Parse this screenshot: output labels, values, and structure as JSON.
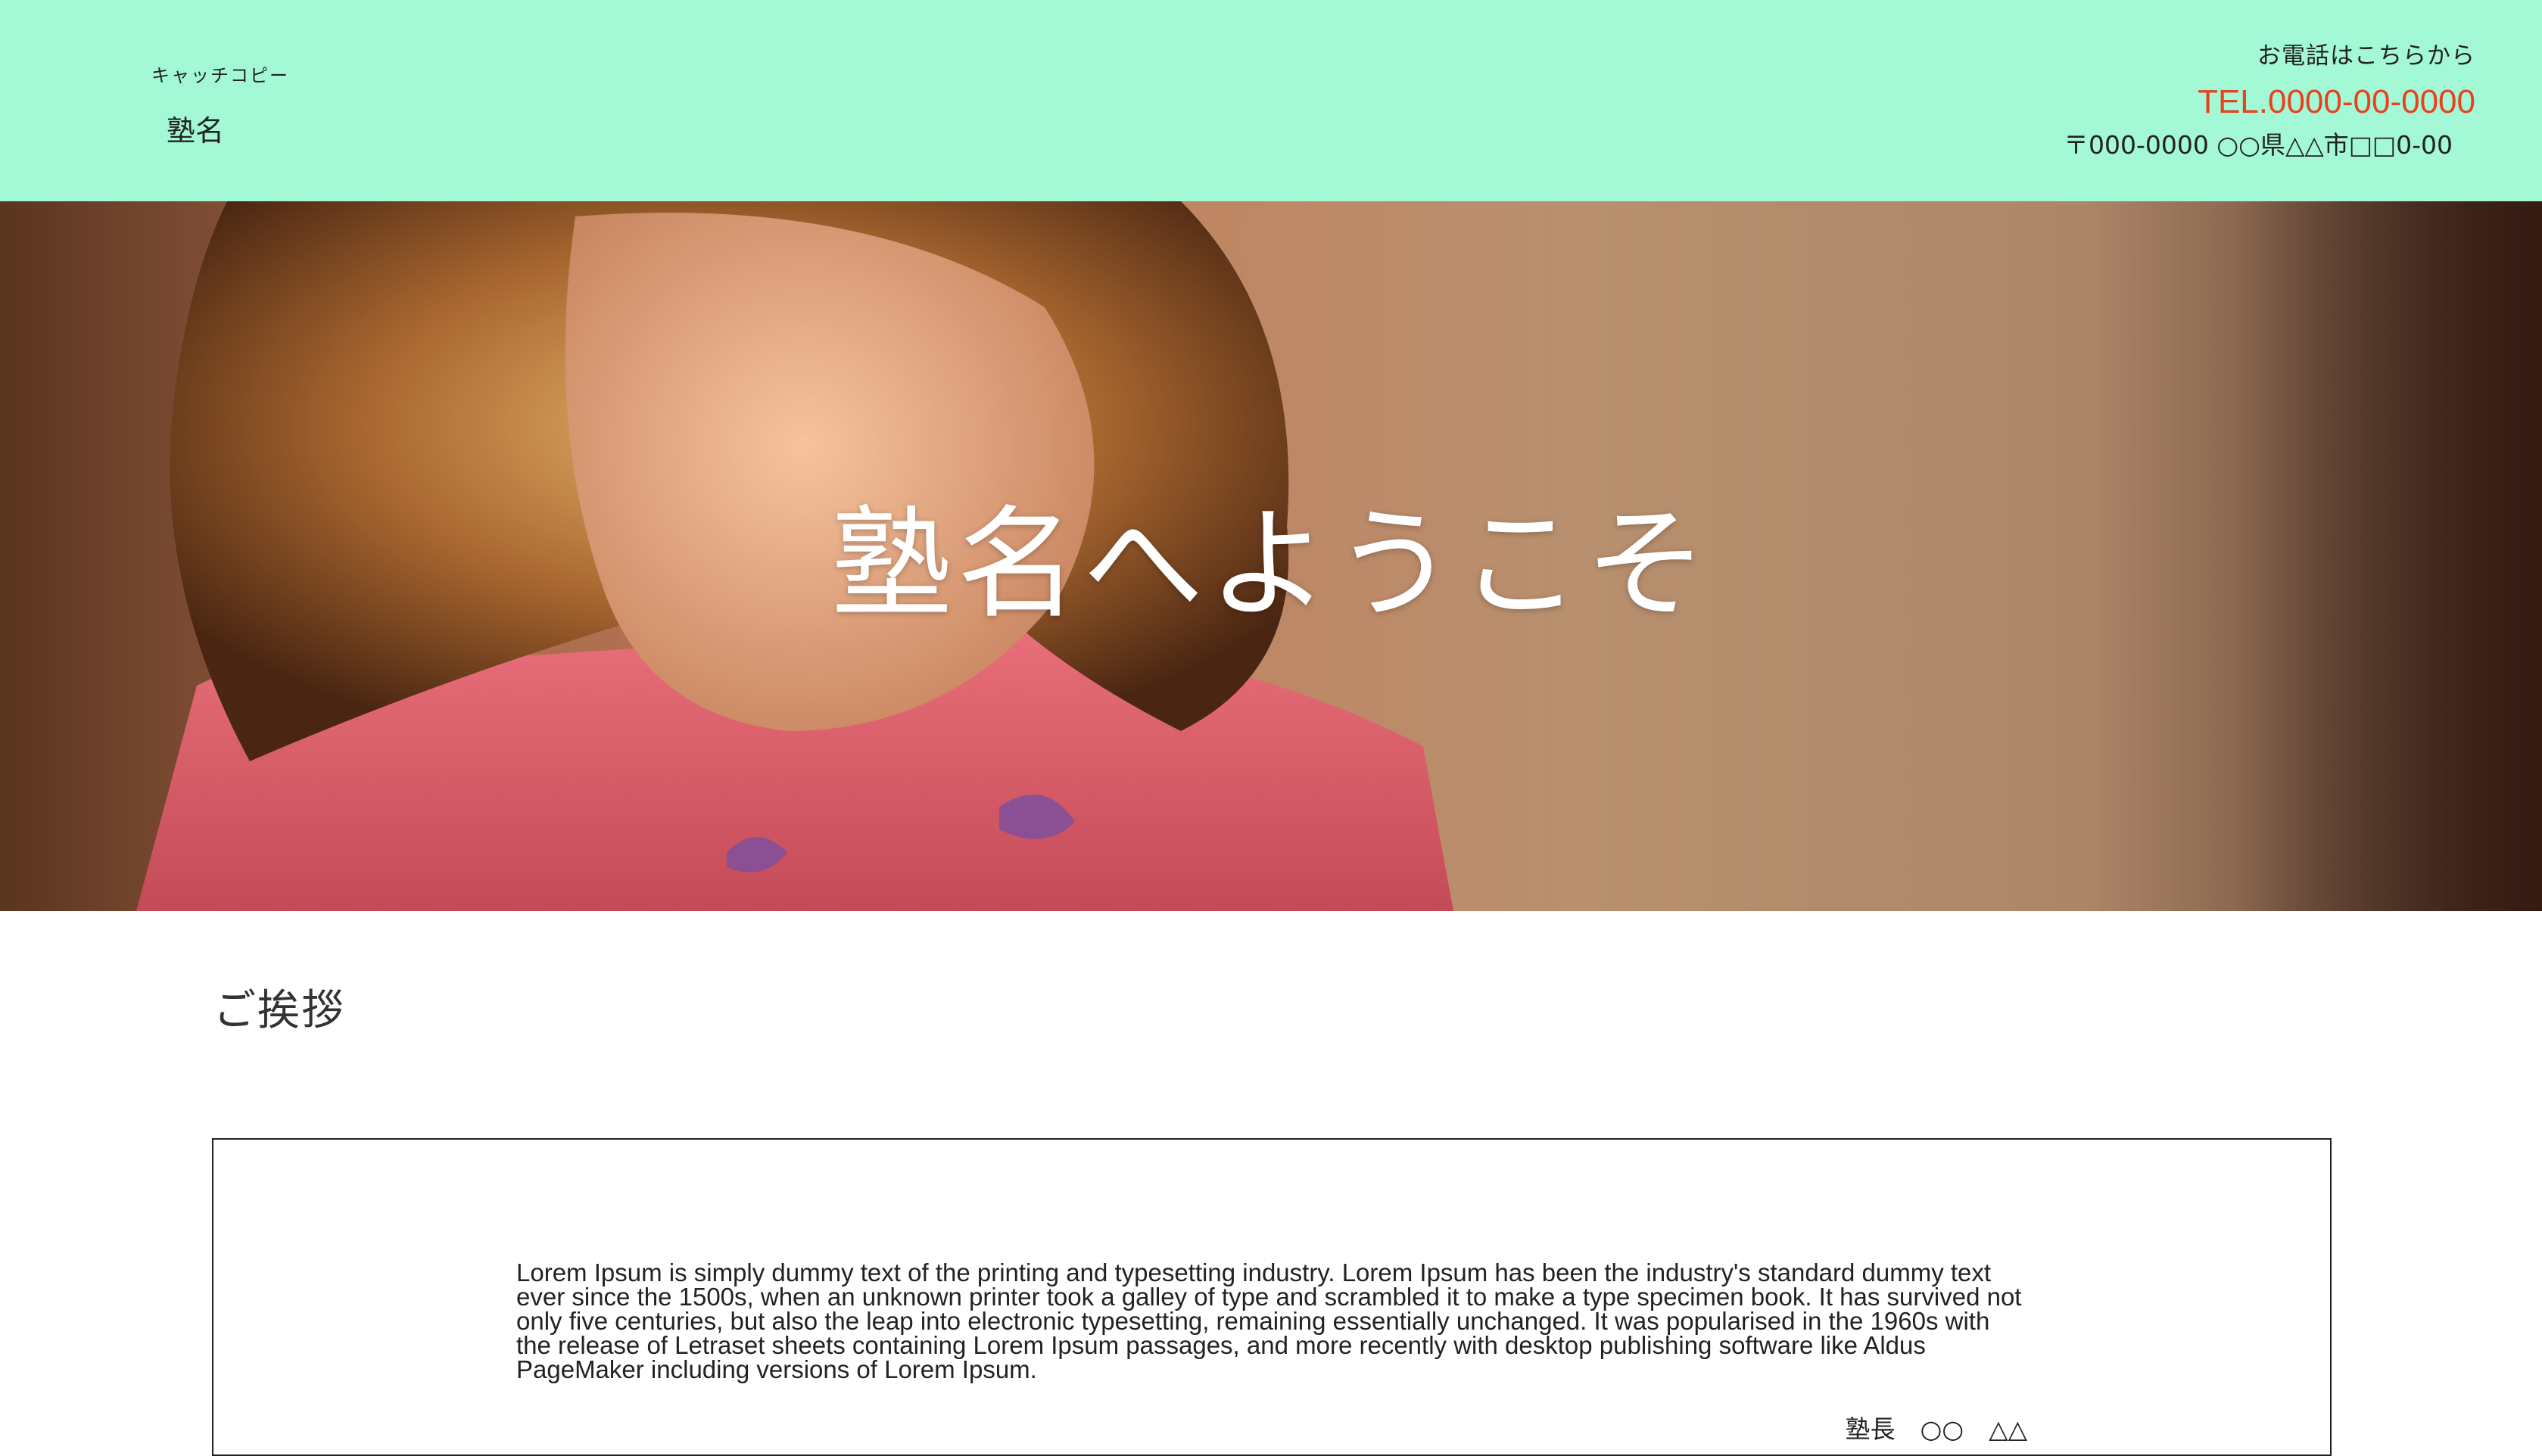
{
  "header": {
    "catch_copy": "キャッチコピー",
    "site_name": "塾名",
    "contact_lead": "お電話はこちらから",
    "tel": "TEL.0000-00-0000",
    "address": "〒000-0000 ○○県△△市□□0-00"
  },
  "hero": {
    "title": "塾名へようこそ"
  },
  "greeting": {
    "heading": "ご挨拶",
    "body": "Lorem Ipsum is simply dummy text of the printing and typesetting industry. Lorem Ipsum has been the industry's standard dummy text ever since the 1500s, when an unknown printer took a galley of type and scrambled it to make a type specimen book. It has survived not only five centuries, but also the leap into electronic typesetting, remaining essentially unchanged. It was popularised in the 1960s with the release of Letraset sheets containing Lorem Ipsum passages, and more recently with desktop publishing software like Aldus PageMaker including versions of Lorem Ipsum.",
    "signature": "塾長　○○　△△"
  },
  "colors": {
    "header_bg": "#a3f8d5",
    "tel": "#e8411f"
  }
}
